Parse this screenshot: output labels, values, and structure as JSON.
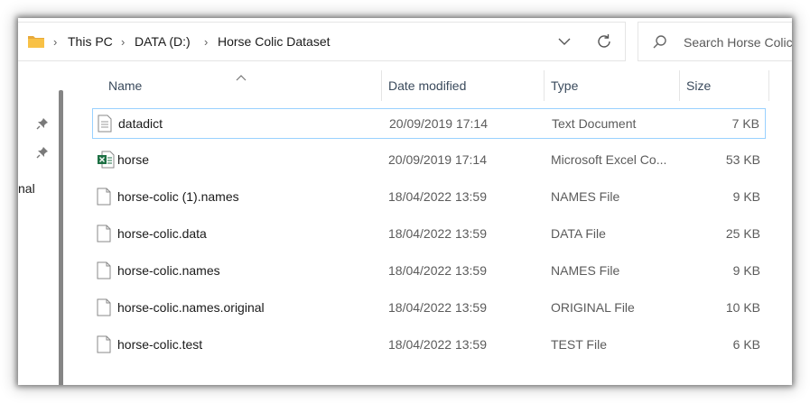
{
  "breadcrumbs": [
    "This PC",
    "DATA (D:)",
    "Horse Colic Dataset"
  ],
  "search": {
    "placeholder": "Search Horse Colic Dataset"
  },
  "nav": {
    "partial_label": "nal"
  },
  "columns": {
    "name": "Name",
    "date": "Date modified",
    "type": "Type",
    "size": "Size"
  },
  "files": [
    {
      "name": "datadict",
      "date": "20/09/2019 17:14",
      "type": "Text Document",
      "size": "7 KB",
      "icon": "text-document-icon"
    },
    {
      "name": "horse",
      "date": "20/09/2019 17:14",
      "type": "Microsoft Excel Co...",
      "size": "53 KB",
      "icon": "excel-icon"
    },
    {
      "name": "horse-colic (1).names",
      "date": "18/04/2022 13:59",
      "type": "NAMES File",
      "size": "9 KB",
      "icon": "file-icon"
    },
    {
      "name": "horse-colic.data",
      "date": "18/04/2022 13:59",
      "type": "DATA File",
      "size": "25 KB",
      "icon": "file-icon"
    },
    {
      "name": "horse-colic.names",
      "date": "18/04/2022 13:59",
      "type": "NAMES File",
      "size": "9 KB",
      "icon": "file-icon"
    },
    {
      "name": "horse-colic.names.original",
      "date": "18/04/2022 13:59",
      "type": "ORIGINAL File",
      "size": "10 KB",
      "icon": "file-icon"
    },
    {
      "name": "horse-colic.test",
      "date": "18/04/2022 13:59",
      "type": "TEST File",
      "size": "6 KB",
      "icon": "file-icon"
    }
  ],
  "colors": {
    "selection_border": "#99d1ff",
    "folder": "#f8c146",
    "excel": "#1d7044"
  }
}
